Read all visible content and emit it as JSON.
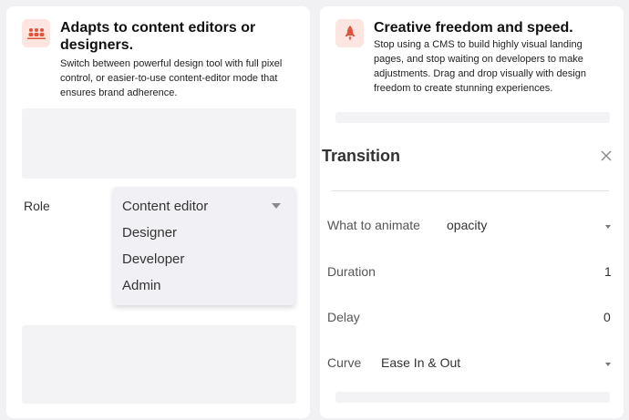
{
  "left_card": {
    "icon": "team-icon",
    "title": "Adapts to content editors or designers.",
    "description": "Switch between powerful design tool with full pixel control, or easier-to-use content-editor mode that ensures brand adherence.",
    "role_label": "Role",
    "role_select": {
      "selected": "Content editor",
      "options": [
        "Designer",
        "Developer",
        "Admin"
      ]
    }
  },
  "right_card": {
    "icon": "rocket-icon",
    "title": "Creative freedom and speed.",
    "description": "Stop using a CMS to build highly visual landing pages, and stop waiting on developers to make adjustments. Drag and drop visually with design freedom to create stunning experiences.",
    "panel": {
      "title": "Transition",
      "what_to_animate_label": "What to animate",
      "what_to_animate_value": "opacity",
      "duration_label": "Duration",
      "duration_value": "1",
      "delay_label": "Delay",
      "delay_value": "0",
      "curve_label": "Curve",
      "curve_value": "Ease In & Out"
    }
  },
  "colors": {
    "accent": "#e0533c",
    "icon_bg": "#fde6e1",
    "page_bg": "#f1f1f4",
    "card_bg": "#ffffff",
    "block_bg": "#f3f3f6"
  }
}
